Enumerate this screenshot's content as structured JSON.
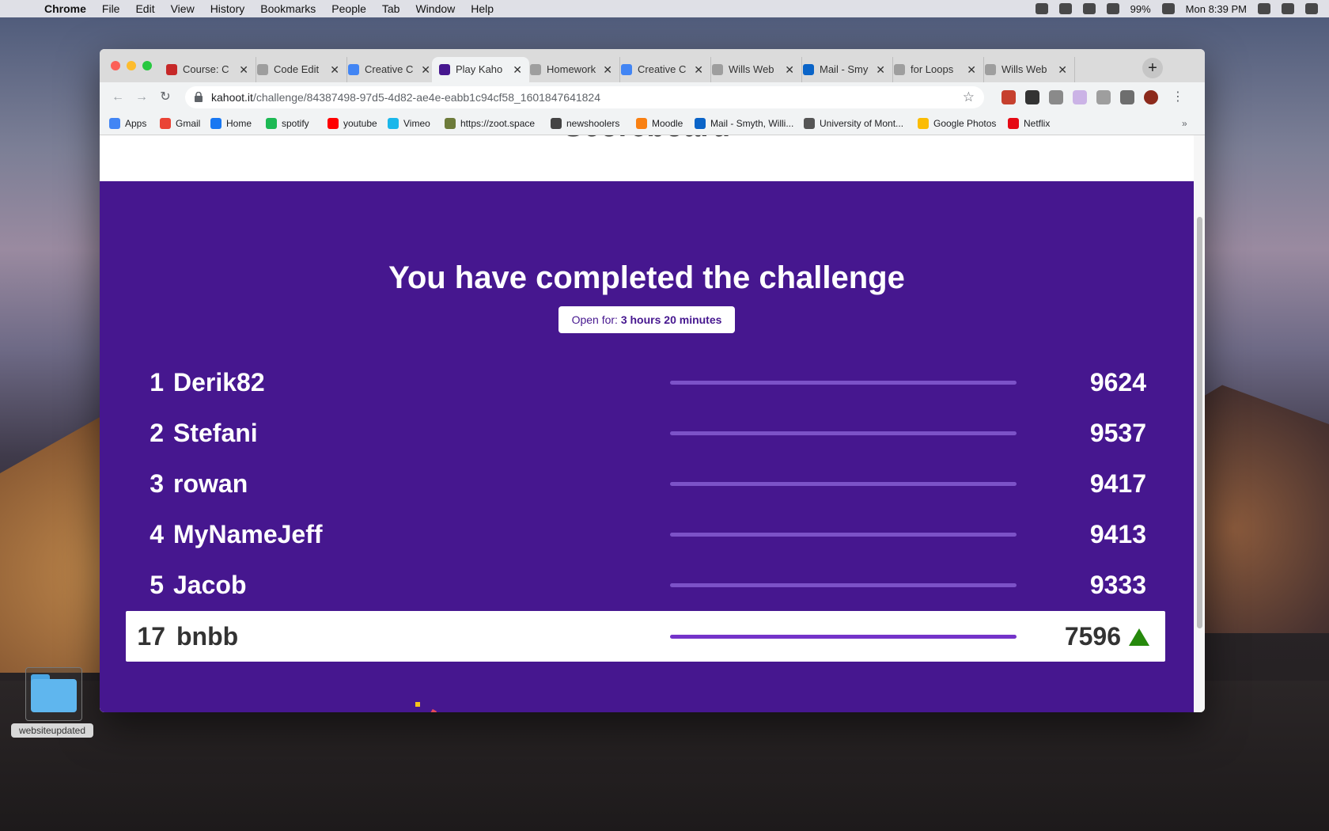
{
  "menubar": {
    "app": "Chrome",
    "items": [
      "File",
      "Edit",
      "View",
      "History",
      "Bookmarks",
      "People",
      "Tab",
      "Window",
      "Help"
    ],
    "battery": "99%",
    "clock": "Mon 8:39 PM"
  },
  "tabs": [
    {
      "label": "Course: C",
      "favicon_color": "#c62828"
    },
    {
      "label": "Code Edit",
      "favicon_color": "#9e9e9e"
    },
    {
      "label": "Creative C",
      "favicon_color": "#4285f4"
    },
    {
      "label": "Play Kaho",
      "favicon_color": "#46178f",
      "active": true
    },
    {
      "label": "Homework",
      "favicon_color": "#9e9e9e"
    },
    {
      "label": "Creative C",
      "favicon_color": "#4285f4"
    },
    {
      "label": "Wills Web",
      "favicon_color": "#9e9e9e"
    },
    {
      "label": "Mail - Smy",
      "favicon_color": "#0a64c8"
    },
    {
      "label": "for Loops",
      "favicon_color": "#9e9e9e"
    },
    {
      "label": "Wills Web",
      "favicon_color": "#9e9e9e"
    }
  ],
  "address": {
    "host": "kahoot.it",
    "path": "/challenge/84387498-97d5-4d82-ae4e-eabb1c94cf58_1601847641824"
  },
  "bookmarks": [
    {
      "label": "Apps",
      "color": "#4285f4"
    },
    {
      "label": "Gmail",
      "color": "#ea4335"
    },
    {
      "label": "Home",
      "color": "#1877f2"
    },
    {
      "label": "spotify",
      "color": "#1db954"
    },
    {
      "label": "youtube",
      "color": "#ff0000"
    },
    {
      "label": "Vimeo",
      "color": "#1ab7ea"
    },
    {
      "label": "https://zoot.space",
      "color": "#6d7b3a"
    },
    {
      "label": "newshoolers",
      "color": "#444444"
    },
    {
      "label": "Moodle",
      "color": "#f98012"
    },
    {
      "label": "Mail - Smyth, Willi...",
      "color": "#0a64c8"
    },
    {
      "label": "University of Mont...",
      "color": "#555555"
    },
    {
      "label": "Google Photos",
      "color": "#fbbc04"
    },
    {
      "label": "Netflix",
      "color": "#e50914"
    }
  ],
  "page": {
    "section_title": "Scoreboard",
    "headline": "You have completed the challenge",
    "open_for_label": "Open for:",
    "open_for_value": "3 hours 20 minutes",
    "leaderboard": [
      {
        "rank": "1",
        "name": "Derik82",
        "score": "9624",
        "fraction": 1.0
      },
      {
        "rank": "2",
        "name": "Stefani",
        "score": "9537",
        "fraction": 1.0
      },
      {
        "rank": "3",
        "name": "rowan",
        "score": "9417",
        "fraction": 1.0
      },
      {
        "rank": "4",
        "name": "MyNameJeff",
        "score": "9413",
        "fraction": 1.0
      },
      {
        "rank": "5",
        "name": "Jacob",
        "score": "9333",
        "fraction": 1.0
      }
    ],
    "me": {
      "rank": "17",
      "name": "bnbb",
      "score": "7596",
      "fraction": 1.0,
      "trend": "up"
    }
  },
  "desktop": {
    "folder_label": "websiteupdated"
  }
}
